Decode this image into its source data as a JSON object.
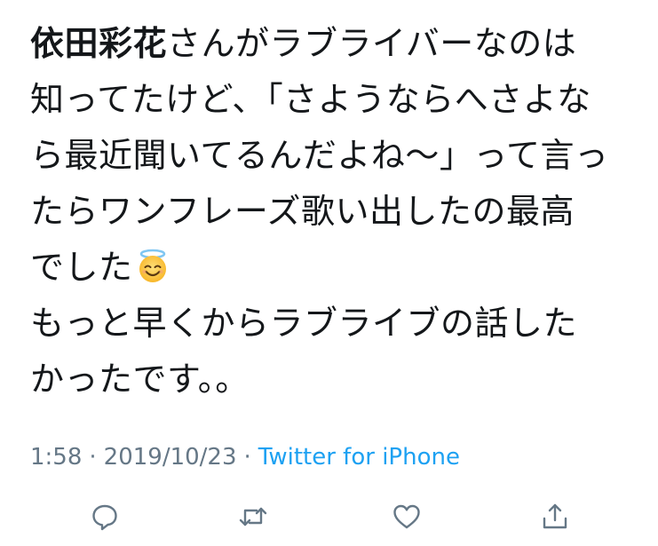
{
  "tweet": {
    "lines": [
      {
        "bold": "依田彩花",
        "text": "さんがラブライバーなのは"
      },
      {
        "text": "知ってたけど、「さようならへさよな"
      },
      {
        "text": "ら最近聞いてるんだよね〜」って言っ"
      },
      {
        "text": "たらワンフレーズ歌い出したの最高"
      },
      {
        "text": "でした"
      },
      {
        "text": "もっと早くからラブライブの話した"
      },
      {
        "text": "かったです。。"
      }
    ],
    "emoji": "smiling-face-with-halo"
  },
  "meta": {
    "time": "1:58",
    "separator": "·",
    "date": "2019/10/23",
    "source": "Twitter for iPhone"
  },
  "colors": {
    "text": "#14171a",
    "meta": "#657786",
    "link": "#1da1f2",
    "icon": "#657786"
  },
  "actions": [
    "reply-icon",
    "retweet-icon",
    "like-icon",
    "share-icon"
  ]
}
